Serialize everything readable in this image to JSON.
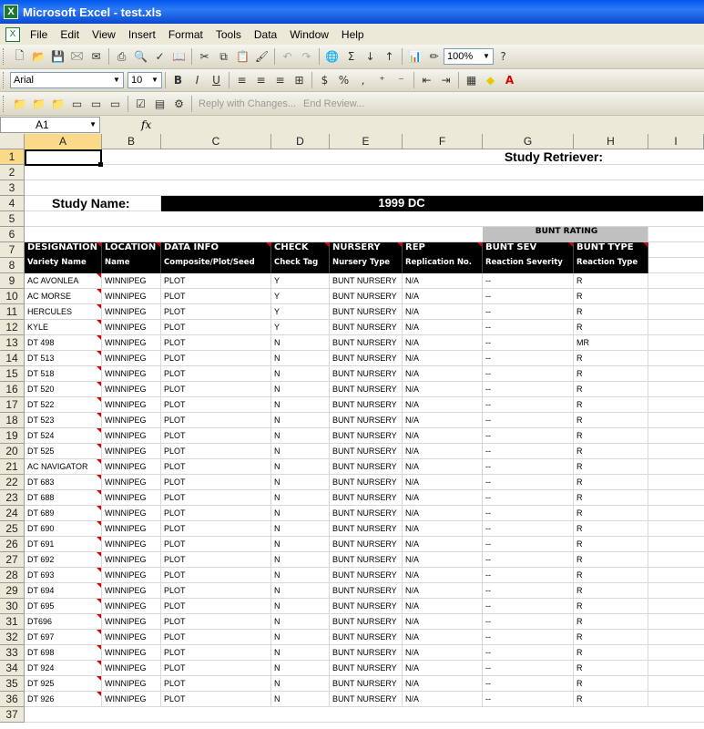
{
  "window": {
    "title": "Microsoft Excel - test.xls"
  },
  "menu": [
    "File",
    "Edit",
    "View",
    "Insert",
    "Format",
    "Tools",
    "Data",
    "Window",
    "Help"
  ],
  "toolbar": {
    "zoom": "100%",
    "font": "Arial",
    "size": "10",
    "reply": "Reply with Changes...",
    "end_review": "End Review..."
  },
  "formula": {
    "cell_ref": "A1",
    "fx": "fx"
  },
  "columns": [
    "A",
    "B",
    "C",
    "D",
    "E",
    "F",
    "G",
    "H",
    "I"
  ],
  "sheet": {
    "retriever": "Study Retriever:",
    "study_name_label": "Study Name:",
    "study_name": "1999 DC",
    "group_header": "BUNT RATING",
    "headers": [
      "DESIGNATION",
      "LOCATION",
      "DATA INFO",
      "CHECK",
      "NURSERY",
      "REP",
      "BUNT SEV",
      "BUNT TYPE"
    ],
    "subheaders": [
      "Variety Name",
      "Name",
      "Composite/Plot/Seed",
      "Check Tag",
      "Nursery Type",
      "Replication No.",
      "Reaction Severity",
      "Reaction Type"
    ],
    "rows": [
      [
        "AC AVONLEA",
        "WINNIPEG",
        "PLOT",
        "Y",
        "BUNT NURSERY",
        "N/A",
        "--",
        "R"
      ],
      [
        "AC MORSE",
        "WINNIPEG",
        "PLOT",
        "Y",
        "BUNT NURSERY",
        "N/A",
        "--",
        "R"
      ],
      [
        "HERCULES",
        "WINNIPEG",
        "PLOT",
        "Y",
        "BUNT NURSERY",
        "N/A",
        "--",
        "R"
      ],
      [
        "KYLE",
        "WINNIPEG",
        "PLOT",
        "Y",
        "BUNT NURSERY",
        "N/A",
        "--",
        "R"
      ],
      [
        "DT 498",
        "WINNIPEG",
        "PLOT",
        "N",
        "BUNT NURSERY",
        "N/A",
        "--",
        "MR"
      ],
      [
        "DT 513",
        "WINNIPEG",
        "PLOT",
        "N",
        "BUNT NURSERY",
        "N/A",
        "--",
        "R"
      ],
      [
        "DT 518",
        "WINNIPEG",
        "PLOT",
        "N",
        "BUNT NURSERY",
        "N/A",
        "--",
        "R"
      ],
      [
        "DT 520",
        "WINNIPEG",
        "PLOT",
        "N",
        "BUNT NURSERY",
        "N/A",
        "--",
        "R"
      ],
      [
        "DT 522",
        "WINNIPEG",
        "PLOT",
        "N",
        "BUNT NURSERY",
        "N/A",
        "--",
        "R"
      ],
      [
        "DT 523",
        "WINNIPEG",
        "PLOT",
        "N",
        "BUNT NURSERY",
        "N/A",
        "--",
        "R"
      ],
      [
        "DT 524",
        "WINNIPEG",
        "PLOT",
        "N",
        "BUNT NURSERY",
        "N/A",
        "--",
        "R"
      ],
      [
        "DT 525",
        "WINNIPEG",
        "PLOT",
        "N",
        "BUNT NURSERY",
        "N/A",
        "--",
        "R"
      ],
      [
        "AC NAVIGATOR",
        "WINNIPEG",
        "PLOT",
        "N",
        "BUNT NURSERY",
        "N/A",
        "--",
        "R"
      ],
      [
        "DT 683",
        "WINNIPEG",
        "PLOT",
        "N",
        "BUNT NURSERY",
        "N/A",
        "--",
        "R"
      ],
      [
        "DT 688",
        "WINNIPEG",
        "PLOT",
        "N",
        "BUNT NURSERY",
        "N/A",
        "--",
        "R"
      ],
      [
        "DT 689",
        "WINNIPEG",
        "PLOT",
        "N",
        "BUNT NURSERY",
        "N/A",
        "--",
        "R"
      ],
      [
        "DT 690",
        "WINNIPEG",
        "PLOT",
        "N",
        "BUNT NURSERY",
        "N/A",
        "--",
        "R"
      ],
      [
        "DT 691",
        "WINNIPEG",
        "PLOT",
        "N",
        "BUNT NURSERY",
        "N/A",
        "--",
        "R"
      ],
      [
        "DT 692",
        "WINNIPEG",
        "PLOT",
        "N",
        "BUNT NURSERY",
        "N/A",
        "--",
        "R"
      ],
      [
        "DT 693",
        "WINNIPEG",
        "PLOT",
        "N",
        "BUNT NURSERY",
        "N/A",
        "--",
        "R"
      ],
      [
        "DT 694",
        "WINNIPEG",
        "PLOT",
        "N",
        "BUNT NURSERY",
        "N/A",
        "--",
        "R"
      ],
      [
        "DT 695",
        "WINNIPEG",
        "PLOT",
        "N",
        "BUNT NURSERY",
        "N/A",
        "--",
        "R"
      ],
      [
        "DT696",
        "WINNIPEG",
        "PLOT",
        "N",
        "BUNT NURSERY",
        "N/A",
        "--",
        "R"
      ],
      [
        "DT 697",
        "WINNIPEG",
        "PLOT",
        "N",
        "BUNT NURSERY",
        "N/A",
        "--",
        "R"
      ],
      [
        "DT 698",
        "WINNIPEG",
        "PLOT",
        "N",
        "BUNT NURSERY",
        "N/A",
        "--",
        "R"
      ],
      [
        "DT 924",
        "WINNIPEG",
        "PLOT",
        "N",
        "BUNT NURSERY",
        "N/A",
        "--",
        "R"
      ],
      [
        "DT 925",
        "WINNIPEG",
        "PLOT",
        "N",
        "BUNT NURSERY",
        "N/A",
        "--",
        "R"
      ],
      [
        "DT 926",
        "WINNIPEG",
        "PLOT",
        "N",
        "BUNT NURSERY",
        "N/A",
        "--",
        "R"
      ]
    ]
  }
}
